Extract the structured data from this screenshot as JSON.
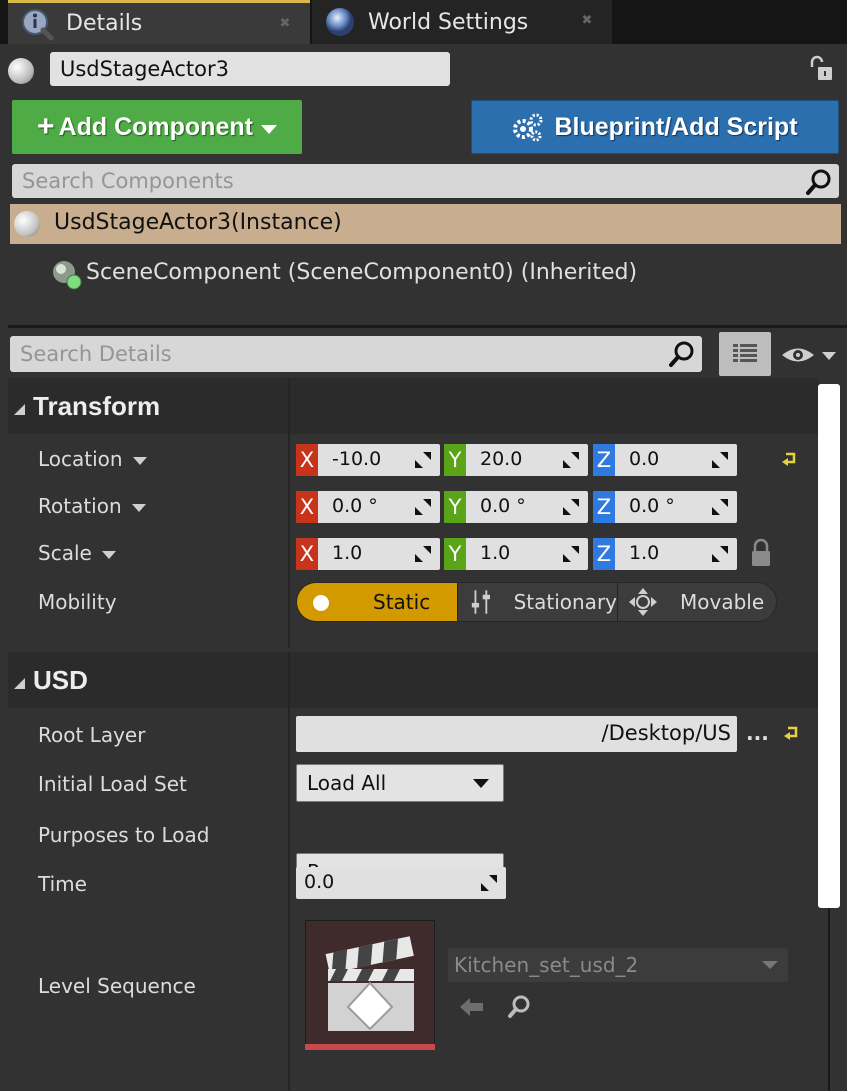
{
  "tabs": [
    {
      "label": "Details",
      "icon": "info-icon",
      "active": true
    },
    {
      "label": "World Settings",
      "icon": "globe-icon",
      "active": false
    }
  ],
  "actor": {
    "name": "UsdStageActor3"
  },
  "toolbar": {
    "add_component_label": "Add Component",
    "blueprint_label": "Blueprint/Add Script"
  },
  "component_search": {
    "placeholder": "Search Components"
  },
  "components": {
    "selected": "UsdStageActor3(Instance)",
    "child": "SceneComponent (SceneComponent0) (Inherited)"
  },
  "details_search": {
    "placeholder": "Search Details"
  },
  "transform": {
    "header": "Transform",
    "location": {
      "label": "Location",
      "x": "-10.0",
      "y": "20.0",
      "z": "0.0"
    },
    "rotation": {
      "label": "Rotation",
      "x": "0.0 °",
      "y": "0.0 °",
      "z": "0.0 °"
    },
    "scale": {
      "label": "Scale",
      "x": "1.0",
      "y": "1.0",
      "z": "1.0"
    },
    "axis_labels": {
      "x": "X",
      "y": "Y",
      "z": "Z"
    },
    "mobility": {
      "label": "Mobility",
      "options": [
        "Static",
        "Stationary",
        "Movable"
      ],
      "selected": "Static"
    }
  },
  "usd": {
    "header": "USD",
    "root_layer": {
      "label": "Root Layer",
      "value": "/Desktop/US",
      "browse": "..."
    },
    "initial_load_set": {
      "label": "Initial Load Set",
      "value": "Load All"
    },
    "purposes": {
      "label": "Purposes to Load",
      "value": "Proxy"
    },
    "time": {
      "label": "Time",
      "value": "0.0"
    },
    "level_sequence": {
      "label": "Level Sequence",
      "value": "Kitchen_set_usd_2"
    }
  },
  "colors": {
    "add_button": "#4fab46",
    "blueprint_button": "#2c6fae",
    "selected_row": "#c8ad8e",
    "mobility_selected": "#d39a00",
    "axis_x": "#c8341b",
    "axis_y": "#5aa418",
    "axis_z": "#2f7ae0"
  }
}
